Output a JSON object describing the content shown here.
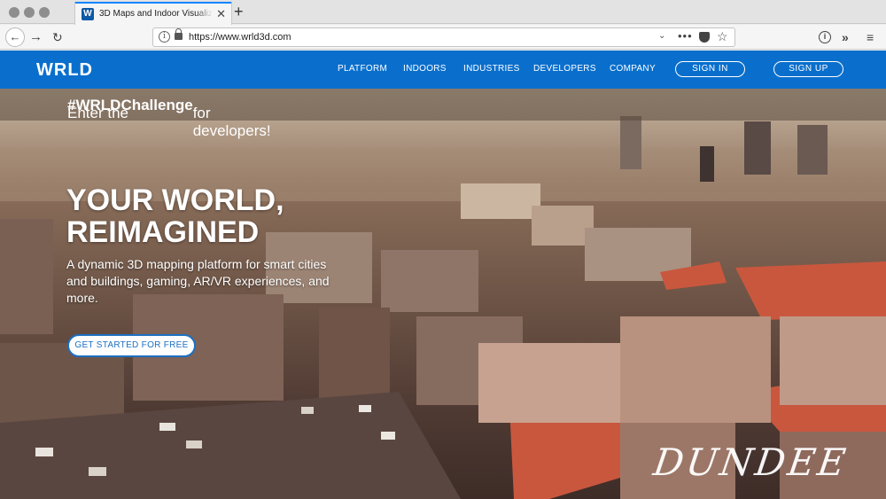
{
  "browser": {
    "tab_title": "3D Maps and Indoor Visualizati",
    "tab_favicon": "W",
    "tab_close": "✕",
    "new_tab": "+",
    "url": "https://www.wrld3d.com",
    "icons": {
      "back": "←",
      "forward": "→",
      "reload": "↻",
      "dots": "•••",
      "star": "☆",
      "overflow": "»",
      "menu": "≡",
      "caret": "⌄"
    }
  },
  "site": {
    "logo": "WRLD",
    "nav": [
      "PLATFORM",
      "INDOORS",
      "INDUSTRIES",
      "DEVELOPERS",
      "COMPANY"
    ],
    "sign_in": "SIGN IN",
    "sign_up": "SIGN UP",
    "brand_color": "#0a6fcc"
  },
  "hero": {
    "challenge_prefix": "Enter the ",
    "challenge_tag": "#WRLDChallenge",
    "challenge_suffix": " for developers!",
    "title_line1": "YOUR WORLD,",
    "title_line2": "REIMAGINED",
    "subtitle": "A dynamic 3D mapping platform for smart cities and buildings, gaming, AR/VR experiences, and more.",
    "cta": "GET STARTED FOR FREE",
    "city_label": "DUNDEE"
  }
}
